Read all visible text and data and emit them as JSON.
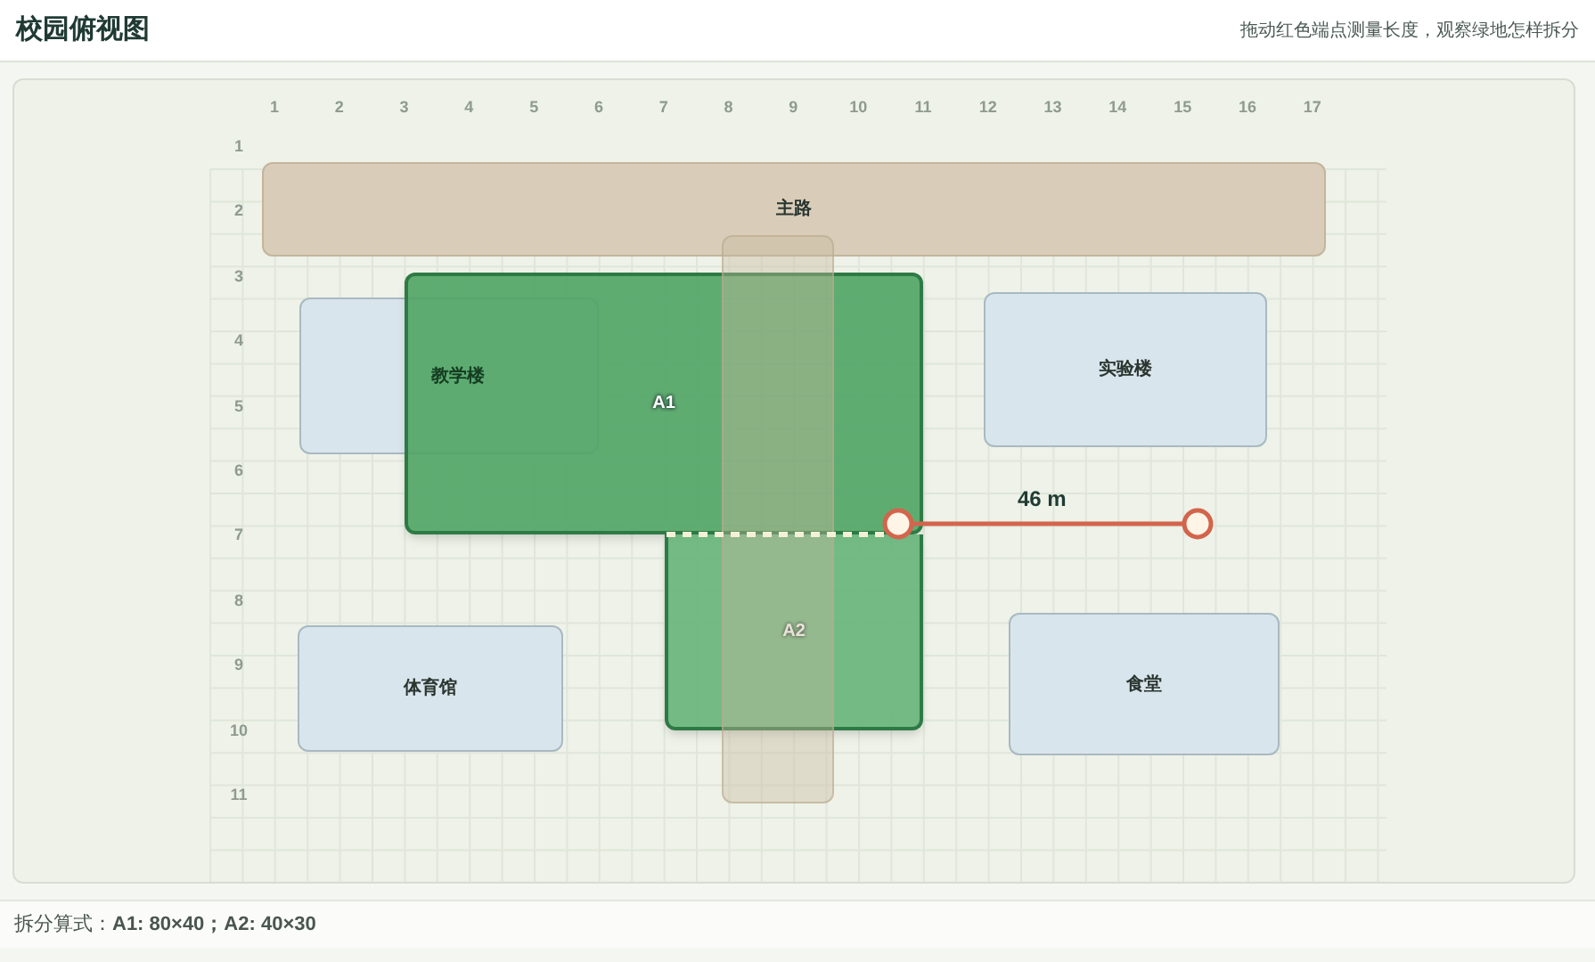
{
  "header": {
    "title": "校园俯视图",
    "hint": "拖动红色端点测量长度，观察绿地怎样拆分"
  },
  "map": {
    "column_labels": [
      "1",
      "2",
      "3",
      "4",
      "5",
      "6",
      "7",
      "8",
      "9",
      "10",
      "11",
      "12",
      "13",
      "14",
      "15",
      "16",
      "17"
    ],
    "row_labels": [
      "1",
      "2",
      "3",
      "4",
      "5",
      "6",
      "7",
      "8",
      "9",
      "10",
      "11"
    ],
    "roads": [
      {
        "kind": "main",
        "label": "主路"
      },
      {
        "kind": "cross"
      }
    ],
    "buildings": [
      {
        "label": "教学楼",
        "covered": true
      },
      {
        "label": "实验楼",
        "covered": false
      },
      {
        "label": "体育馆",
        "covered": false
      },
      {
        "label": "食堂",
        "covered": false
      }
    ],
    "green_parts": [
      {
        "label": "A1",
        "kind": "upper"
      },
      {
        "label": "A2",
        "kind": "lower"
      }
    ],
    "measure": {
      "reading": "46 m"
    }
  },
  "formula": "拆分算式：**A1: 80×40；A2: 40×30**"
}
